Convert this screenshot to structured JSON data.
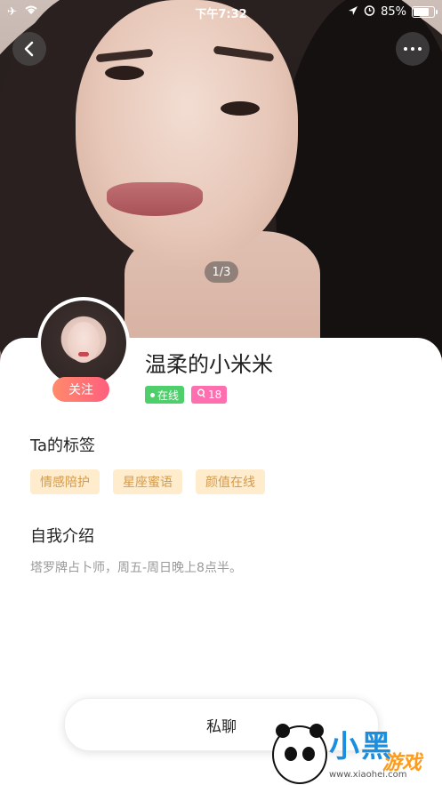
{
  "status_bar": {
    "time": "下午7:32",
    "battery": "85%",
    "battery_level": 0.85
  },
  "gallery": {
    "pager": "1/3"
  },
  "profile": {
    "name": "温柔的小米米",
    "follow_label": "关注",
    "online_label": "在线",
    "age_label": "18"
  },
  "tags_section": {
    "title": "Ta的标签",
    "tags": [
      "情感陪护",
      "星座蜜语",
      "颜值在线"
    ]
  },
  "intro_section": {
    "title": "自我介绍",
    "text": "塔罗牌占卜师，周五-周日晚上8点半。"
  },
  "actions": {
    "chat_label": "私聊"
  },
  "watermark": {
    "logo": "小黑",
    "sub": "游戏",
    "url": "www.xiaohei.com"
  },
  "colors": {
    "follow_gradient": [
      "#ff8a6b",
      "#ff5f7e"
    ],
    "online_badge": "#4fcf6b",
    "age_badge": "#ff6fb0",
    "tag_bg": "#ffeccd",
    "tag_text": "#d49a4a"
  },
  "icons": [
    "airplane-icon",
    "wifi-icon",
    "location-icon",
    "alarm-icon",
    "battery-icon",
    "back-icon",
    "more-icon",
    "female-icon"
  ]
}
